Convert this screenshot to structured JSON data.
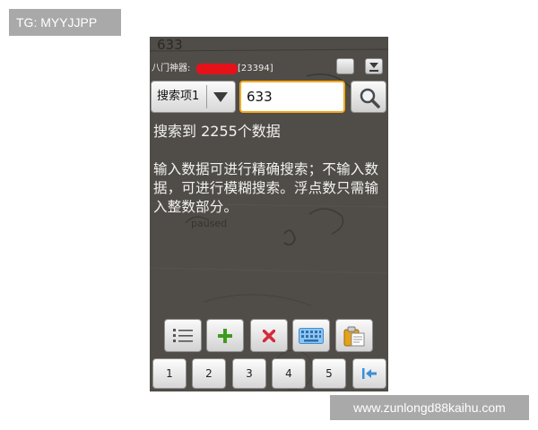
{
  "watermarks": {
    "top": "TG: MYYJJPP",
    "bottom": "www.zunlongd88kaihu.com"
  },
  "screen": {
    "doodle_top": "633",
    "doodle_paused": "paused",
    "status": {
      "app_name": "八门神器: ",
      "process_id": "[23394]"
    },
    "search": {
      "dropdown_label": "搜索项1",
      "input_value": "633",
      "search_icon": "magnifier-icon"
    },
    "result_count": "搜索到 2255个数据",
    "hint": "输入数据可进行精确搜索；不输入数据，可进行模糊搜索。浮点数只需输入整数部分。",
    "toolbar": [
      {
        "name": "list-button",
        "icon": "list-icon"
      },
      {
        "name": "add-button",
        "icon": "plus-icon",
        "color": "#3f9b1e"
      },
      {
        "name": "delete-button",
        "icon": "close-icon",
        "color": "#d62a3a"
      },
      {
        "name": "keyboard-button",
        "icon": "keyboard-icon",
        "color": "#3b8fd8"
      },
      {
        "name": "paste-button",
        "icon": "clipboard-icon",
        "color": "#e3a21b"
      }
    ],
    "numpad": [
      "1",
      "2",
      "3",
      "4",
      "5"
    ],
    "numpad_last_icon": "jump-to-start-icon",
    "accent_color": "#f3a81e",
    "redaction_color": "#e5121a"
  }
}
